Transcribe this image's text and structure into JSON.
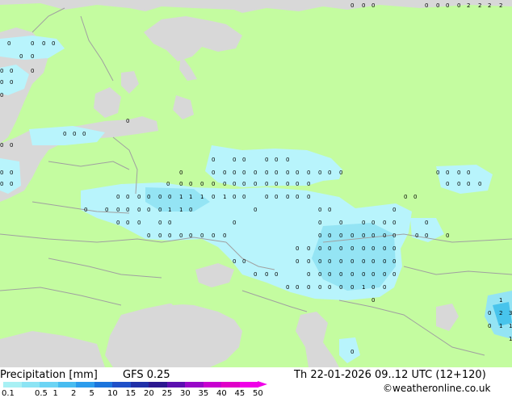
{
  "title": "Precipitation [mm]",
  "model": "GFS 0.25",
  "valid_time": "Th 22-01-2026 09..12 UTC (12+120)",
  "credit": "©weatheronline.co.uk",
  "legend": {
    "ticks": [
      "0.1",
      "0.5",
      "1",
      "2",
      "5",
      "10",
      "15",
      "20",
      "25",
      "30",
      "35",
      "40",
      "45",
      "50"
    ],
    "colors": [
      "#a8f0f4",
      "#8ce4f4",
      "#6cd4f4",
      "#48bcf0",
      "#2c9cec",
      "#1c74dc",
      "#2050c8",
      "#2030a8",
      "#2c1890",
      "#5c10b0",
      "#9808c8",
      "#c800d0",
      "#e000c8",
      "#f000e8"
    ]
  },
  "colors": {
    "land": "#c4fca0",
    "sea": "#d8d8d8",
    "precip_light": "#b8f4fc",
    "precip_medium": "#94e4f4",
    "precip_heavy": "#48c4ec",
    "border": "#a0a0a0"
  }
}
